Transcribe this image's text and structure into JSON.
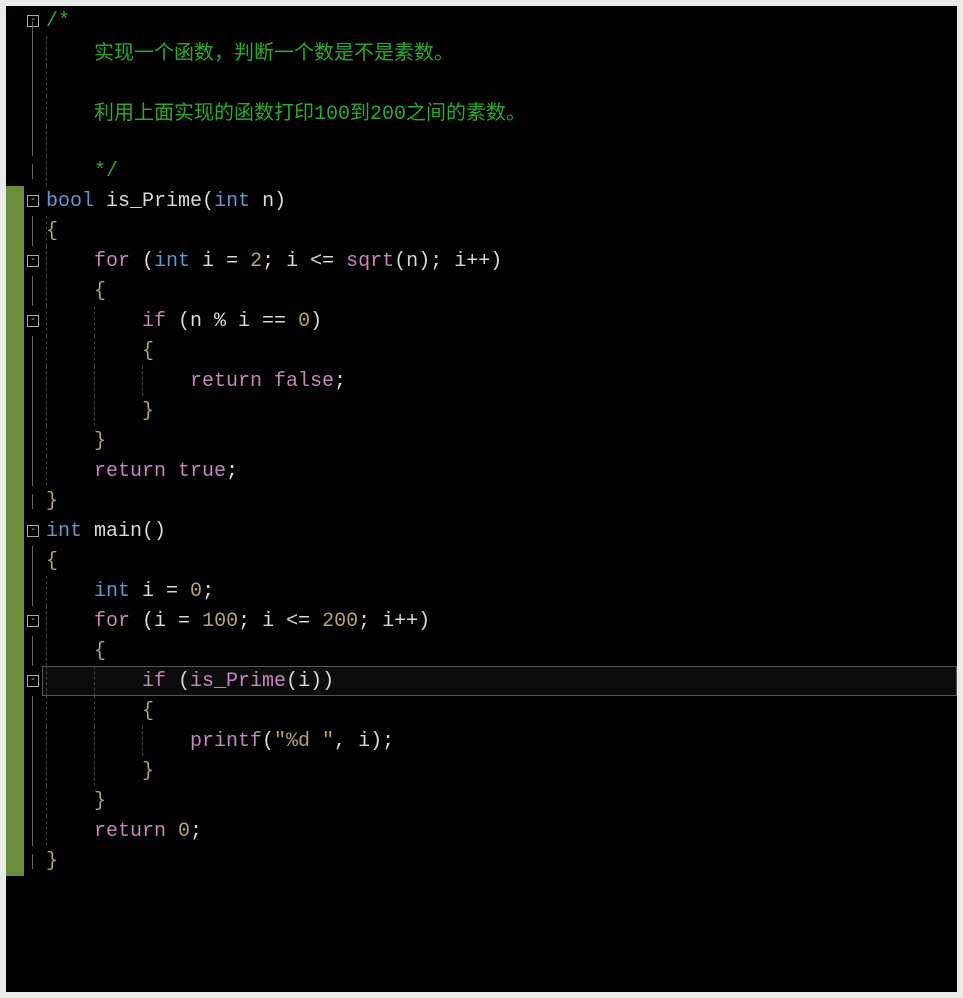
{
  "code": {
    "comment_open": "/*",
    "comment_line1": "实现一个函数，判断一个数是不是素数。",
    "comment_blank": "",
    "comment_line2": "利用上面实现的函数打印100到200之间的素数。",
    "comment_blank2": "",
    "comment_close": "*/",
    "fn1_sig_type": "bool",
    "fn1_sig_name": " is_Prime",
    "fn1_sig_p1": "(",
    "fn1_sig_ptype": "int",
    "fn1_sig_pname": " n",
    "fn1_sig_p2": ")",
    "brace_open": "{",
    "brace_close": "}",
    "fn1_for_kw": "for ",
    "fn1_for_paren1": "(",
    "fn1_for_decl_type": "int",
    "fn1_for_decl_name": " i ",
    "fn1_for_eq": "=",
    "fn1_for_init_val": " 2",
    "fn1_for_semi1": "; ",
    "fn1_for_cond_i": "i ",
    "fn1_for_cond_op": "<=",
    "fn1_for_cond_sqrt": " sqrt",
    "fn1_for_cond_p1": "(",
    "fn1_for_cond_n": "n",
    "fn1_for_cond_p2": ")",
    "fn1_for_semi2": "; ",
    "fn1_for_inc": "i++",
    "fn1_for_paren2": ")",
    "fn1_if_kw": "if ",
    "fn1_if_p1": "(",
    "fn1_if_expr": "n % i ",
    "fn1_if_op": "==",
    "fn1_if_val": " 0",
    "fn1_if_p2": ")",
    "fn1_return_kw": "return",
    "fn1_return_false": " false",
    "fn1_return_true": " true",
    "semi": ";",
    "fn2_sig_type": "int",
    "fn2_sig_name": " main",
    "fn2_sig_parens": "()",
    "fn2_decl_type": "int",
    "fn2_decl_name": " i ",
    "fn2_decl_eq": "=",
    "fn2_decl_val": " 0",
    "fn2_for_kw": "for ",
    "fn2_for_p1": "(",
    "fn2_for_init_i": "i ",
    "fn2_for_init_eq": "=",
    "fn2_for_init_val": " 100",
    "fn2_for_semi1": "; ",
    "fn2_for_cond_i": "i ",
    "fn2_for_cond_op": "<=",
    "fn2_for_cond_val": " 200",
    "fn2_for_semi2": "; ",
    "fn2_for_inc": "i++",
    "fn2_for_p2": ")",
    "fn2_if_kw": "if ",
    "fn2_if_p1": "(",
    "fn2_if_call": "is_Prime",
    "fn2_if_cp1": "(",
    "fn2_if_arg": "i",
    "fn2_if_cp2": ")",
    "fn2_if_p2": ")",
    "fn2_printf": "printf",
    "fn2_printf_p1": "(",
    "fn2_printf_str": "\"%d \"",
    "fn2_printf_comma": ", ",
    "fn2_printf_arg": "i",
    "fn2_printf_p2": ")",
    "fn2_return_kw": "return",
    "fn2_return_val": " 0"
  },
  "fold": {
    "collapse": "-"
  }
}
